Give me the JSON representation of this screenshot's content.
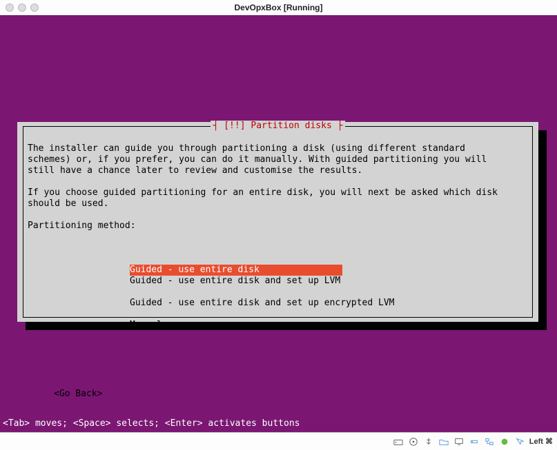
{
  "window": {
    "title": "DevOpxBox [Running]"
  },
  "dialog": {
    "title_left": "┤ ",
    "title_bang": "[!!]",
    "title_text": " Partition disks ",
    "title_right": "├",
    "body_line1": "The installer can guide you through partitioning a disk (using different standard",
    "body_line2": "schemes) or, if you prefer, you can do it manually. With guided partitioning you will",
    "body_line3": "still have a chance later to review and customise the results.",
    "body_line4": "",
    "body_line5": "If you choose guided partitioning for an entire disk, you will next be asked which disk",
    "body_line6": "should be used.",
    "body_line7": "",
    "body_line8": "Partitioning method:",
    "options": [
      "Guided - use entire disk",
      "Guided - use entire disk and set up LVM",
      "Guided - use entire disk and set up encrypted LVM",
      "Manual"
    ],
    "go_back": "<Go Back>"
  },
  "footer": {
    "hint": "<Tab> moves; <Space> selects; <Enter> activates buttons"
  },
  "statusbar": {
    "host_key": "Left ⌘"
  }
}
